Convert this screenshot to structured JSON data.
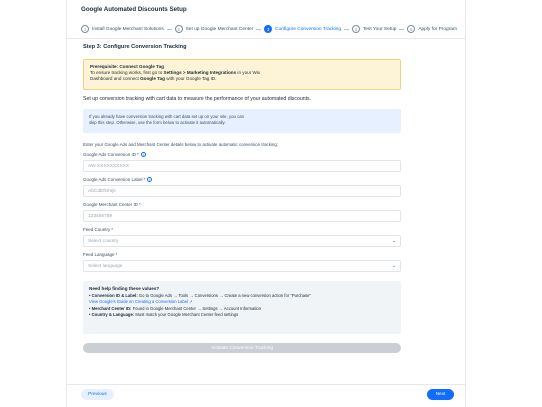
{
  "modal": {
    "title": "Google Automated Discounts Setup"
  },
  "steps": [
    {
      "num": "1",
      "label": "Install Google Merchant Solutions",
      "active": false
    },
    {
      "num": "2",
      "label": "Set up Google Merchant Center",
      "active": false
    },
    {
      "num": "3",
      "label": "Configure Conversion Tracking",
      "active": true
    },
    {
      "num": "4",
      "label": "Test Your Setup",
      "active": false
    },
    {
      "num": "5",
      "label": "Apply for Program",
      "active": false
    }
  ],
  "step_title": "Step 3: Configure Conversion Tracking",
  "prereq": {
    "title": "Prerequisite: Connect Google Tag",
    "line1_a": "To ensure tracking works, first go to ",
    "line1_b": "Settings > Marketing Integrations",
    "line1_c": " in your Wix",
    "line2_a": "Dashboard and connect ",
    "line2_b": "Google Tag",
    "line2_c": " with your Google Tag ID."
  },
  "intro": "Set up conversion tracking with cart data to measure the performance of your automated discounts.",
  "info": {
    "line1": "If you already have conversion tracking with cart data set up on your site, you can",
    "line2": "skip this step. Otherwise, use the form below to activate it automatically."
  },
  "instruct": "Enter your Google Ads and Merchant Center details below to activate automatic conversion tracking:",
  "fields": {
    "conversion_id": {
      "label": "Google Ads Conversion ID",
      "placeholder": "AW-XXXXXXXXXX"
    },
    "conversion_label": {
      "label": "Google Ads Conversion Label",
      "placeholder": "AbCdEfGhIjk"
    },
    "merchant_id": {
      "label": "Google Merchant Center ID",
      "placeholder": "123456789"
    },
    "feed_country": {
      "label": "Feed Country",
      "placeholder": "Select country"
    },
    "feed_language": {
      "label": "Feed Language",
      "placeholder": "Select language"
    }
  },
  "help": {
    "title": "Need help finding these values?",
    "item1_b": "Conversion ID & Label:",
    "item1_t": " Go to Google Ads → Tools → Conversions → Create a new conversion action for \"Purchase\"",
    "link": "View Google's Guide on Creating a Conversion Label ↗",
    "item2_b": "Merchant Center ID:",
    "item2_t": " Found in Google Merchant Center → Settings → Account Information",
    "item3_b": "Country & Language:",
    "item3_t": " Must match your Google Merchant Center feed settings"
  },
  "activate_label": "Activate Conversion Tracking",
  "footer": {
    "previous": "Previous",
    "next": "Next"
  }
}
